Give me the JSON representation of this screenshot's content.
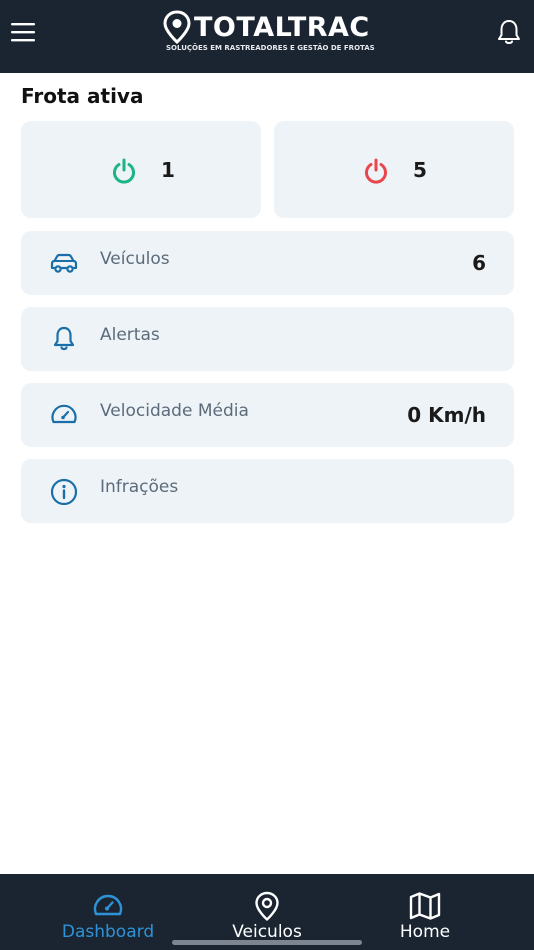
{
  "header": {
    "logo_text": "TOTALTRAC",
    "logo_tagline": "SOLUÇÕES EM RASTREADORES E GESTÃO DE FROTAS",
    "icons": {
      "menu": "hamburger-menu-icon",
      "notifications": "bell-icon"
    }
  },
  "fleet": {
    "title": "Frota ativa",
    "online": {
      "value": "1",
      "icon": "power-icon",
      "color": "#1cb386"
    },
    "offline": {
      "value": "5",
      "icon": "power-icon",
      "color": "#e8474c"
    }
  },
  "summary": [
    {
      "label": "Veículos",
      "value": "6",
      "icon": "car-icon"
    },
    {
      "label": "Alertas",
      "value": "",
      "icon": "bell-icon"
    },
    {
      "label": "Velocidade Média",
      "value": "0 Km/h",
      "icon": "speedometer-icon"
    },
    {
      "label": "Infrações",
      "value": "",
      "icon": "info-icon"
    }
  ],
  "bottom_nav": [
    {
      "label": "Dashboard",
      "icon": "speedometer-icon",
      "active": true
    },
    {
      "label": "Veiculos",
      "icon": "location-pin-icon",
      "active": false
    },
    {
      "label": "Home",
      "icon": "map-icon",
      "active": false
    }
  ],
  "colors": {
    "header_bg": "#1b2532",
    "card_bg": "#eef3f7",
    "accent_blue": "#1b6fa8",
    "nav_active": "#2e93d6",
    "nav_inactive": "#ffffff"
  }
}
